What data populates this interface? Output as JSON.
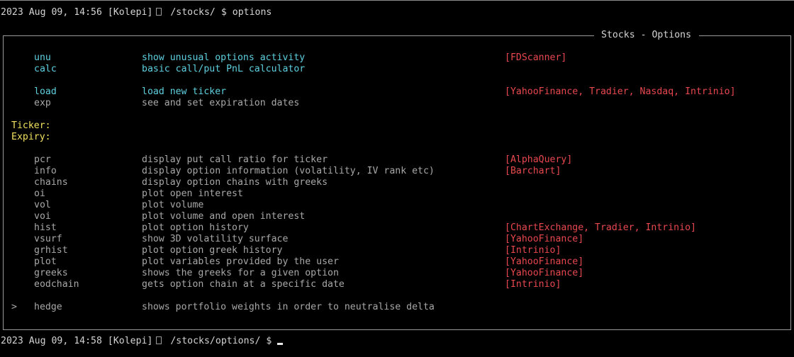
{
  "terminal": {
    "prompt1": {
      "timestamp": "2023 Aug 09, 14:56",
      "user": "[Kolepi]",
      "path": "/stocks/",
      "symbol": "$",
      "command": "options"
    },
    "prompt2": {
      "timestamp": "2023 Aug 09, 14:58",
      "user": "[Kolepi]",
      "path": "/stocks/options/",
      "symbol": "$",
      "command": ""
    }
  },
  "panel": {
    "title": "Stocks - Options",
    "ticker_label": "Ticker:",
    "expiry_label": "Expiry:",
    "menu_marker": ">",
    "commands_top": [
      {
        "cmd": "unu",
        "desc": "show unusual options activity",
        "source": "[FDScanner]"
      },
      {
        "cmd": "calc",
        "desc": "basic call/put PnL calculator",
        "source": ""
      }
    ],
    "commands_load": [
      {
        "cmd": "load",
        "desc": "load new ticker",
        "source": "[YahooFinance, Tradier, Nasdaq, Intrinio]"
      }
    ],
    "commands_exp": [
      {
        "cmd": "exp",
        "desc": "see and set expiration dates",
        "source": ""
      }
    ],
    "commands_main": [
      {
        "cmd": "pcr",
        "desc": "display put call ratio for ticker",
        "source": "[AlphaQuery]"
      },
      {
        "cmd": "info",
        "desc": "display option information (volatility, IV rank etc)",
        "source": "[Barchart]"
      },
      {
        "cmd": "chains",
        "desc": "display option chains with greeks",
        "source": ""
      },
      {
        "cmd": "oi",
        "desc": "plot open interest",
        "source": ""
      },
      {
        "cmd": "vol",
        "desc": "plot volume",
        "source": ""
      },
      {
        "cmd": "voi",
        "desc": "plot volume and open interest",
        "source": ""
      },
      {
        "cmd": "hist",
        "desc": "plot option history",
        "source": "[ChartExchange, Tradier, Intrinio]"
      },
      {
        "cmd": "vsurf",
        "desc": "show 3D volatility surface",
        "source": "[YahooFinance]"
      },
      {
        "cmd": "grhist",
        "desc": "plot option greek history",
        "source": "[Intrinio]"
      },
      {
        "cmd": "plot",
        "desc": "plot variables provided by the user",
        "source": "[YahooFinance]"
      },
      {
        "cmd": "greeks",
        "desc": "shows the greeks for a given option",
        "source": "[YahooFinance]"
      },
      {
        "cmd": "eodchain",
        "desc": "gets option chain at a specific date",
        "source": "[Intrinio]"
      }
    ],
    "submenu": {
      "cmd": "hedge",
      "desc": "shows portfolio weights in order to neutralise delta"
    }
  },
  "colors": {
    "background": "#000000",
    "text": "#d4d4d4",
    "command_active": "#5fd0e0",
    "command_disabled": "#a8a8a8",
    "source": "#e8484e",
    "label": "#f0e060"
  }
}
